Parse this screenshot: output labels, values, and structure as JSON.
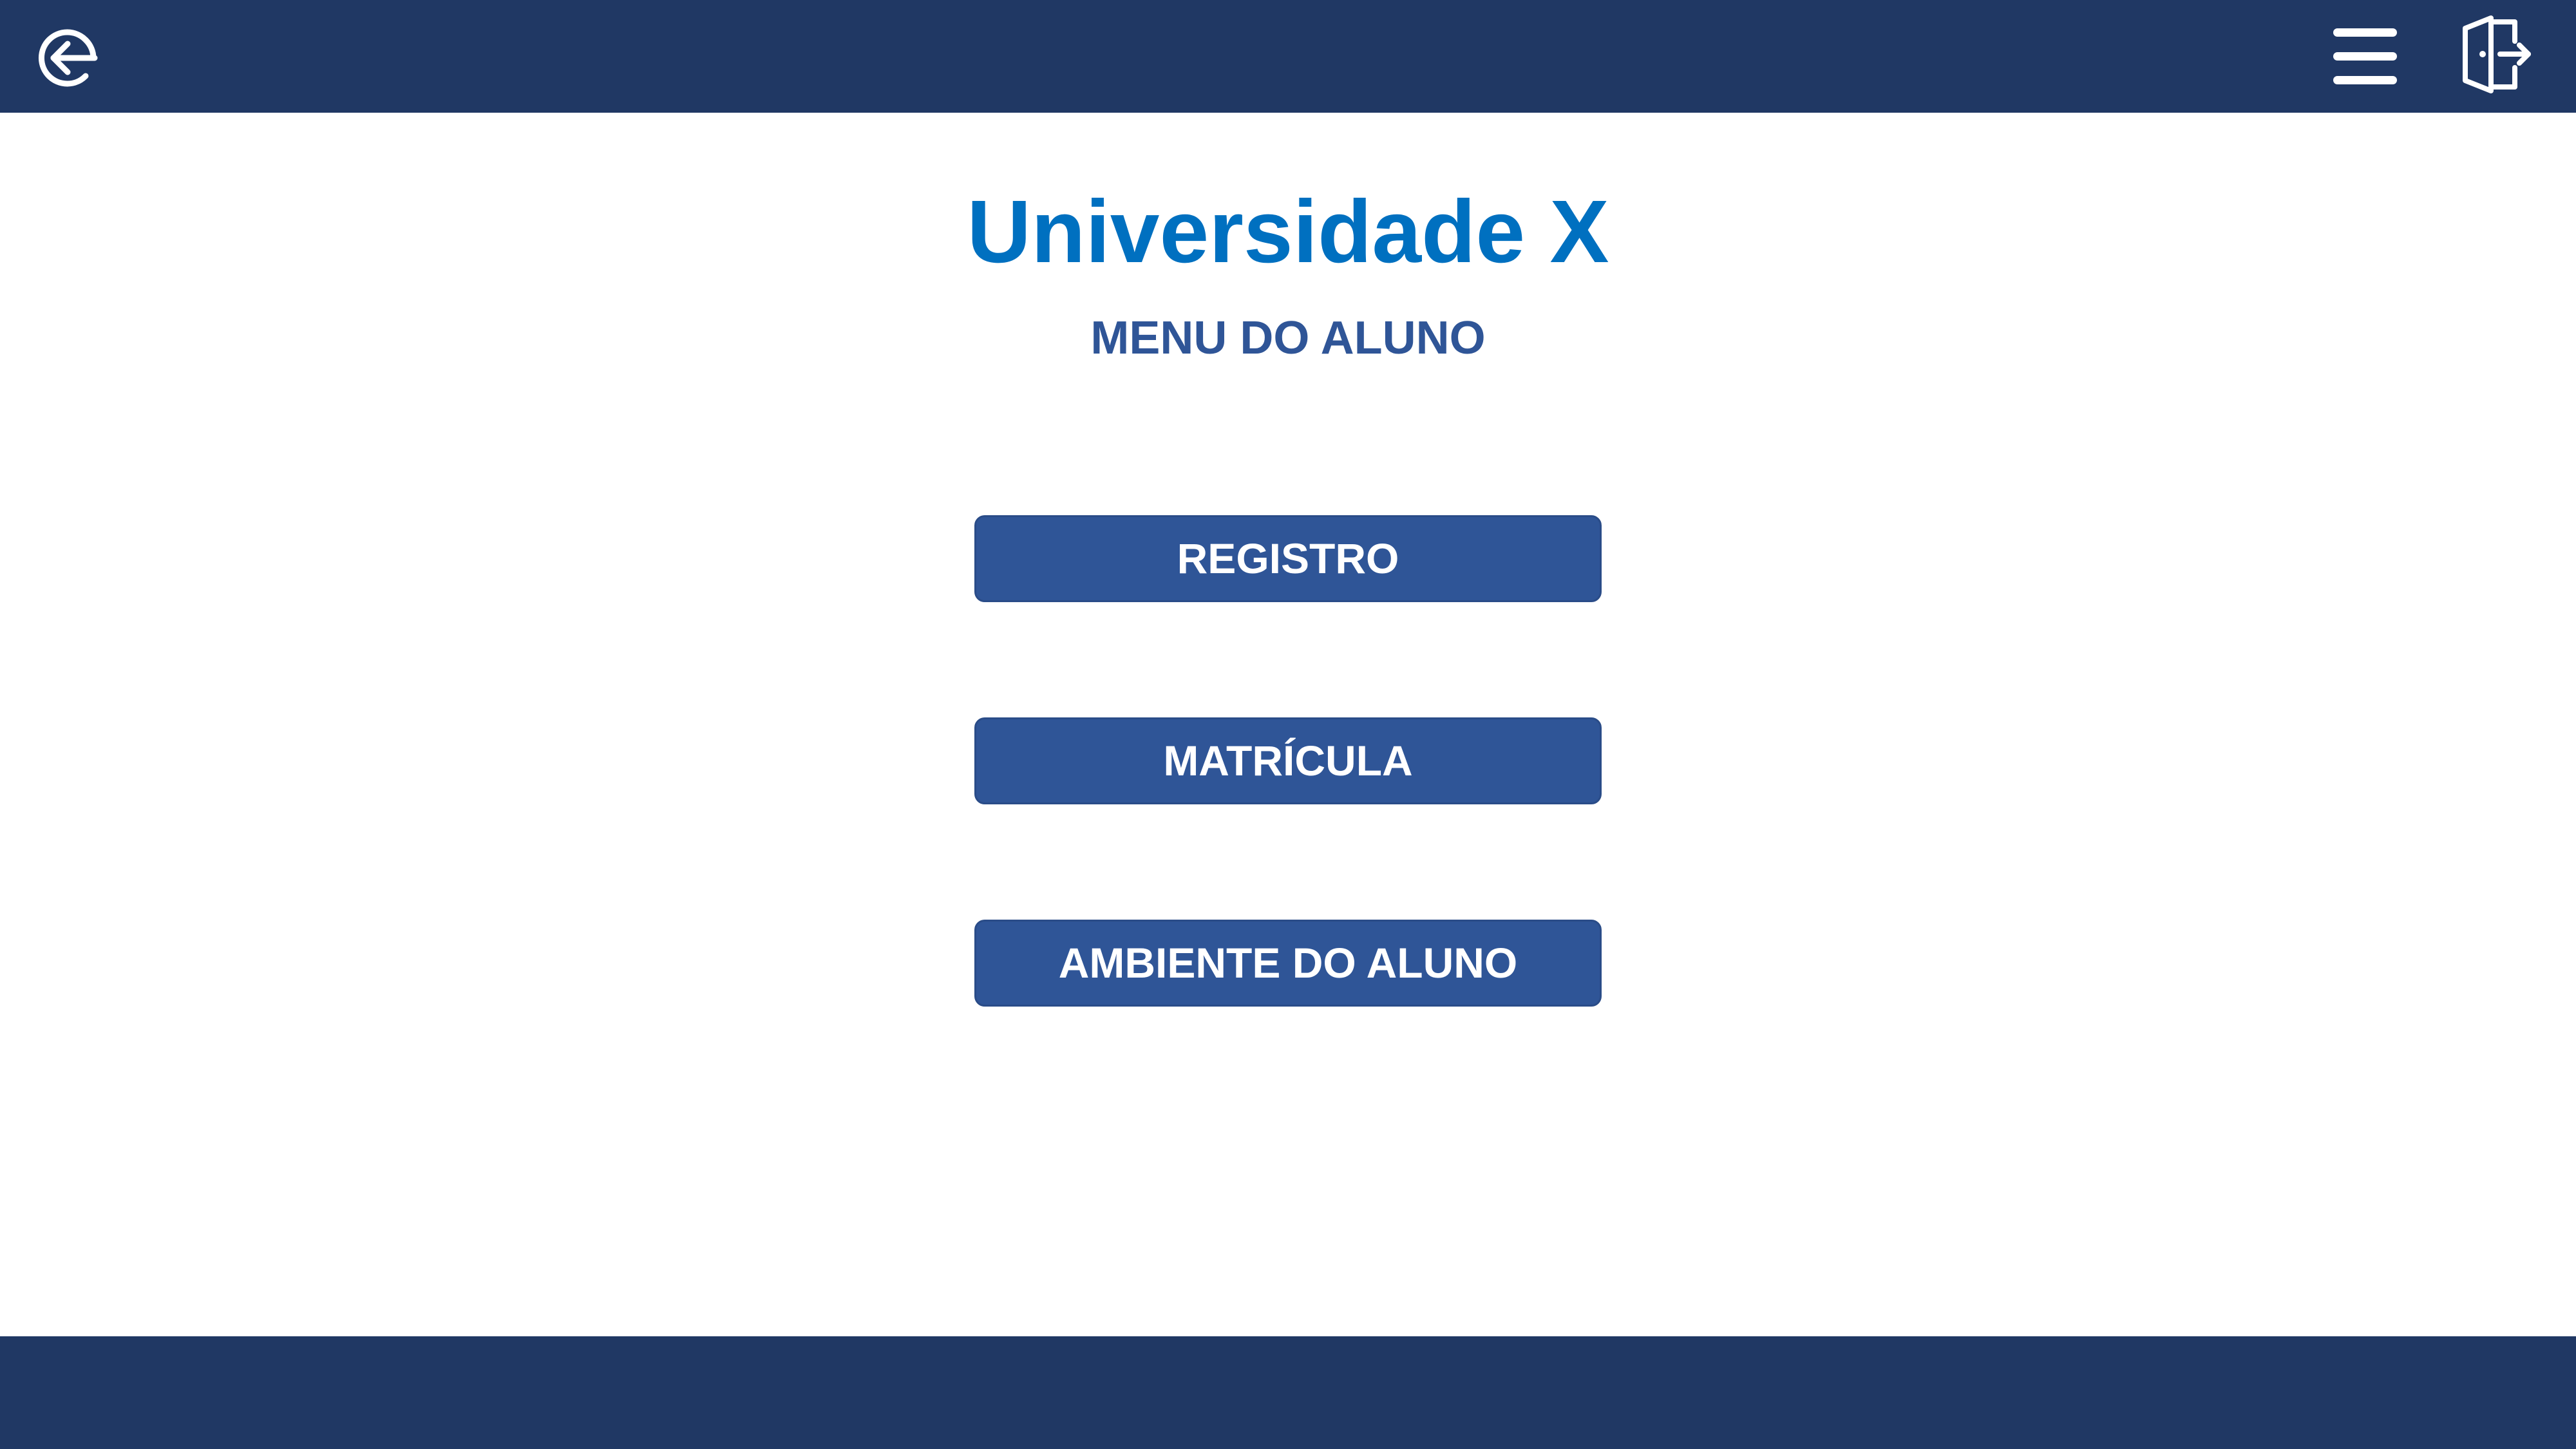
{
  "header": {
    "back_icon": "back-arrow-circle-icon",
    "menu_icon": "hamburger-menu-icon",
    "exit_icon": "logout-door-icon"
  },
  "main": {
    "title": "Universidade X",
    "subtitle": "MENU DO ALUNO",
    "buttons": [
      {
        "label": "REGISTRO"
      },
      {
        "label": "MATRÍCULA"
      },
      {
        "label": "AMBIENTE DO ALUNO"
      }
    ]
  },
  "colors": {
    "bar": "#203864",
    "title": "#0070c0",
    "subtitle": "#2f5597",
    "button": "#2f5597",
    "button_text": "#ffffff"
  }
}
